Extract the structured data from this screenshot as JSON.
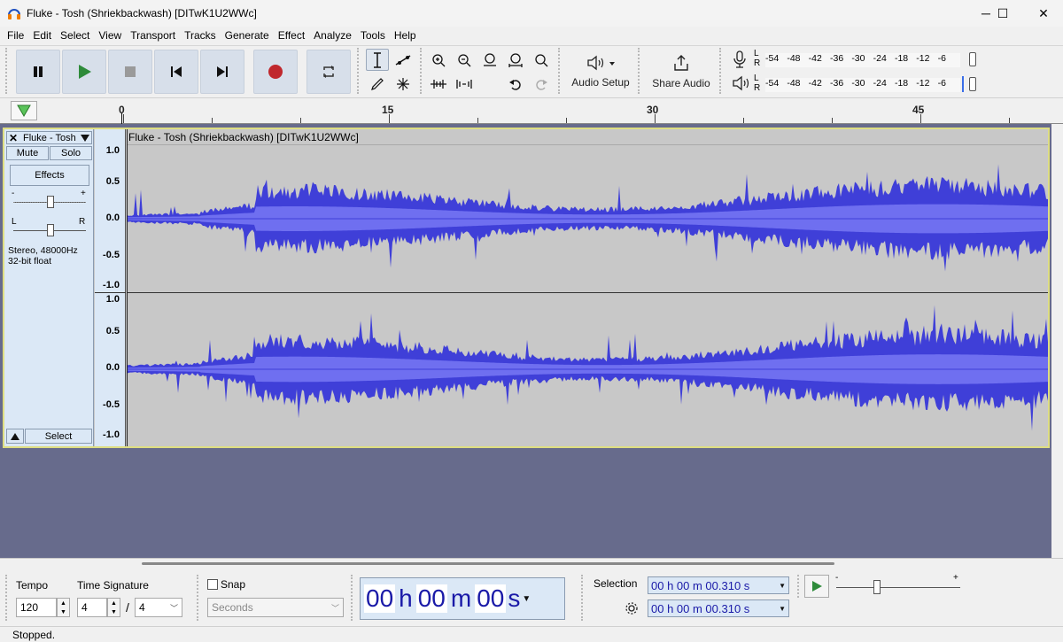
{
  "window": {
    "title": "Fluke - Tosh (Shriekbackwash) [DITwK1U2WWc]"
  },
  "menu": [
    "File",
    "Edit",
    "Select",
    "View",
    "Transport",
    "Tracks",
    "Generate",
    "Effect",
    "Analyze",
    "Tools",
    "Help"
  ],
  "toolbar": {
    "audio_setup_label": "Audio Setup",
    "share_audio_label": "Share Audio",
    "meter_scale": [
      "-54",
      "-48",
      "-42",
      "-36",
      "-30",
      "-24",
      "-18",
      "-12",
      "-6"
    ],
    "rec_channels": [
      "L",
      "R"
    ],
    "play_channels": [
      "L",
      "R"
    ]
  },
  "ruler": {
    "labels": [
      "0",
      "15",
      "30",
      "45"
    ]
  },
  "track": {
    "name": "Fluke - Tosh",
    "clip_title": "Fluke - Tosh (Shriekbackwash) [DITwK1U2WWc]",
    "mute_label": "Mute",
    "solo_label": "Solo",
    "effects_label": "Effects",
    "gain_min": "-",
    "gain_max": "+",
    "pan_left": "L",
    "pan_right": "R",
    "info_line1": "Stereo, 48000Hz",
    "info_line2": "32-bit float",
    "select_label": "Select",
    "vscale": [
      "1.0",
      "0.5",
      "0.0",
      "-0.5",
      "-1.0"
    ],
    "waveform_color": "#3f3fd8",
    "rms_color": "#6f6ff0"
  },
  "bottom": {
    "tempo_label": "Tempo",
    "tempo_value": "120",
    "time_sig_label": "Time Signature",
    "time_sig_num": "4",
    "time_sig_slash": "/",
    "time_sig_den": "4",
    "snap_label": "Snap",
    "snap_unit": "Seconds",
    "time_display": {
      "h": "00",
      "h_unit": "h",
      "m": "00",
      "m_unit": "m",
      "s": "00",
      "s_unit": "s"
    },
    "selection_label": "Selection",
    "selection_start": "00 h 00 m 00.310 s",
    "selection_end": "00 h 00 m 00.310 s",
    "speed_min": "-",
    "speed_max": "+"
  },
  "status": {
    "text": "Stopped."
  }
}
